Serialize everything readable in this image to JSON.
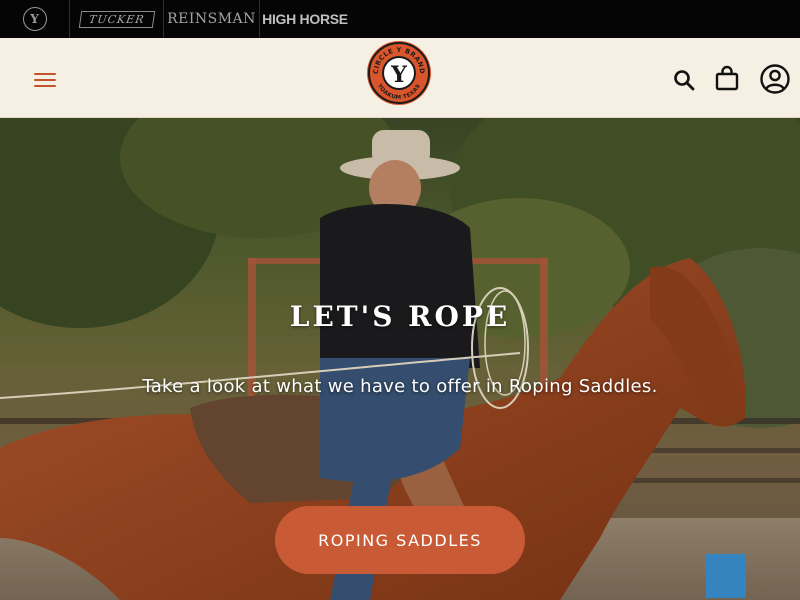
{
  "brands": {
    "circle_y": {
      "letter": "Y",
      "icon": "circle-y-badge-icon"
    },
    "tucker": {
      "label": "TUCKER"
    },
    "reinsman": {
      "label": "REINSMAN"
    },
    "high_horse": {
      "label": "HIGH HORSE"
    }
  },
  "header": {
    "menu_icon": "hamburger-menu-icon",
    "logo": {
      "top_text": "CIRCLE Y BRAND",
      "bottom_text": "YOAKUM TEXAS",
      "letter": "Y"
    },
    "icons": [
      "search-icon",
      "shopping-bag-icon",
      "account-icon"
    ]
  },
  "hero": {
    "title": "LET'S ROPE",
    "subtitle": "Take a look at what we have to offer in Roping Saddles.",
    "cta_label": "ROPING SADDLES"
  },
  "colors": {
    "accent": "#c85a35",
    "header_bg": "#f6efe4",
    "brand_bar_bg": "#050505",
    "logo_ring": "#d9552c"
  }
}
